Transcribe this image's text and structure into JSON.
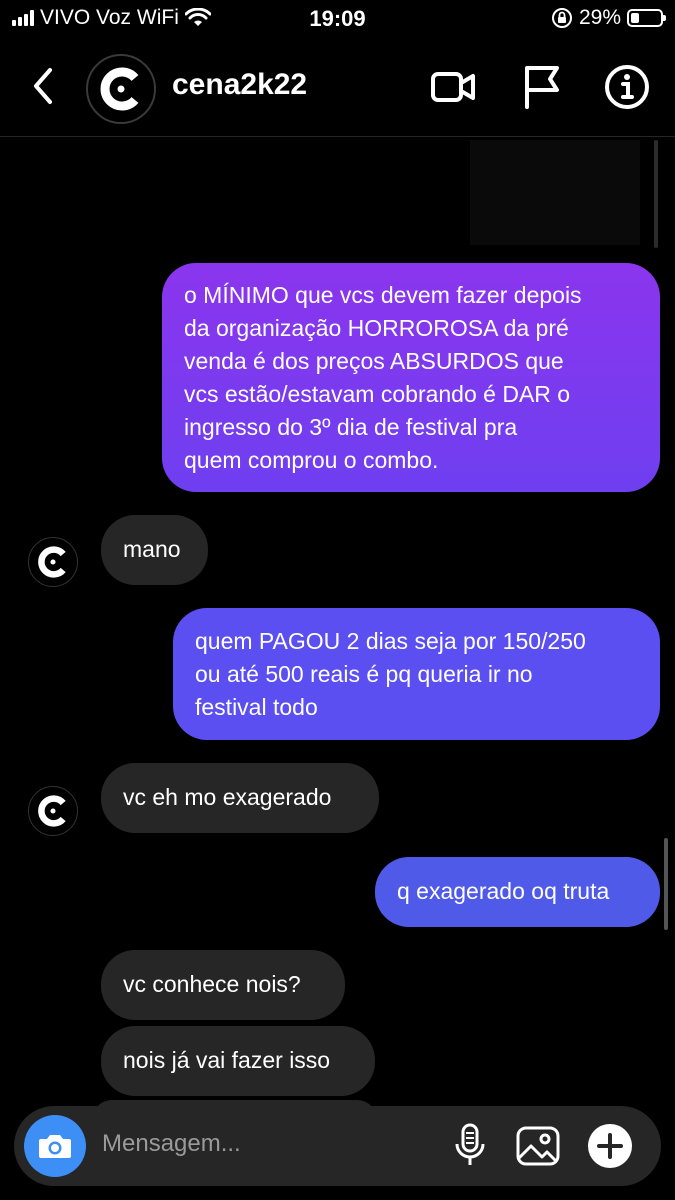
{
  "status": {
    "carrier": "VIVO Voz WiFi",
    "time": "19:09",
    "battery": "29%",
    "battery_level": 0.29
  },
  "header": {
    "username": "cena2k22",
    "icons": [
      "back-icon",
      "video-call-icon",
      "flag-icon",
      "info-icon"
    ]
  },
  "messages": [
    {
      "from": "me",
      "text_lines": [
        "o MÍNIMO que vcs devem fazer depois",
        "da organização HORROROSA da pré",
        "venda é dos preços ABSURDOS que",
        "vcs estão/estavam cobrando é DAR o",
        "ingresso do 3º dia de festival pra",
        "quem comprou o combo."
      ]
    },
    {
      "from": "them",
      "text": "mano"
    },
    {
      "from": "me",
      "text_lines": [
        "quem PAGOU 2 dias seja por 150/250",
        "ou até 500 reais é pq queria ir no",
        "festival todo"
      ]
    },
    {
      "from": "them",
      "text": "vc eh mo exagerado"
    },
    {
      "from": "me",
      "text": "q exagerado oq truta"
    },
    {
      "from": "them",
      "text": "vc conhece nois?"
    },
    {
      "from": "them",
      "text": "nois já vai fazer isso"
    }
  ],
  "composer": {
    "placeholder": "Mensagem...",
    "icons": [
      "camera-icon",
      "microphone-icon",
      "gallery-icon",
      "add-icon"
    ]
  }
}
